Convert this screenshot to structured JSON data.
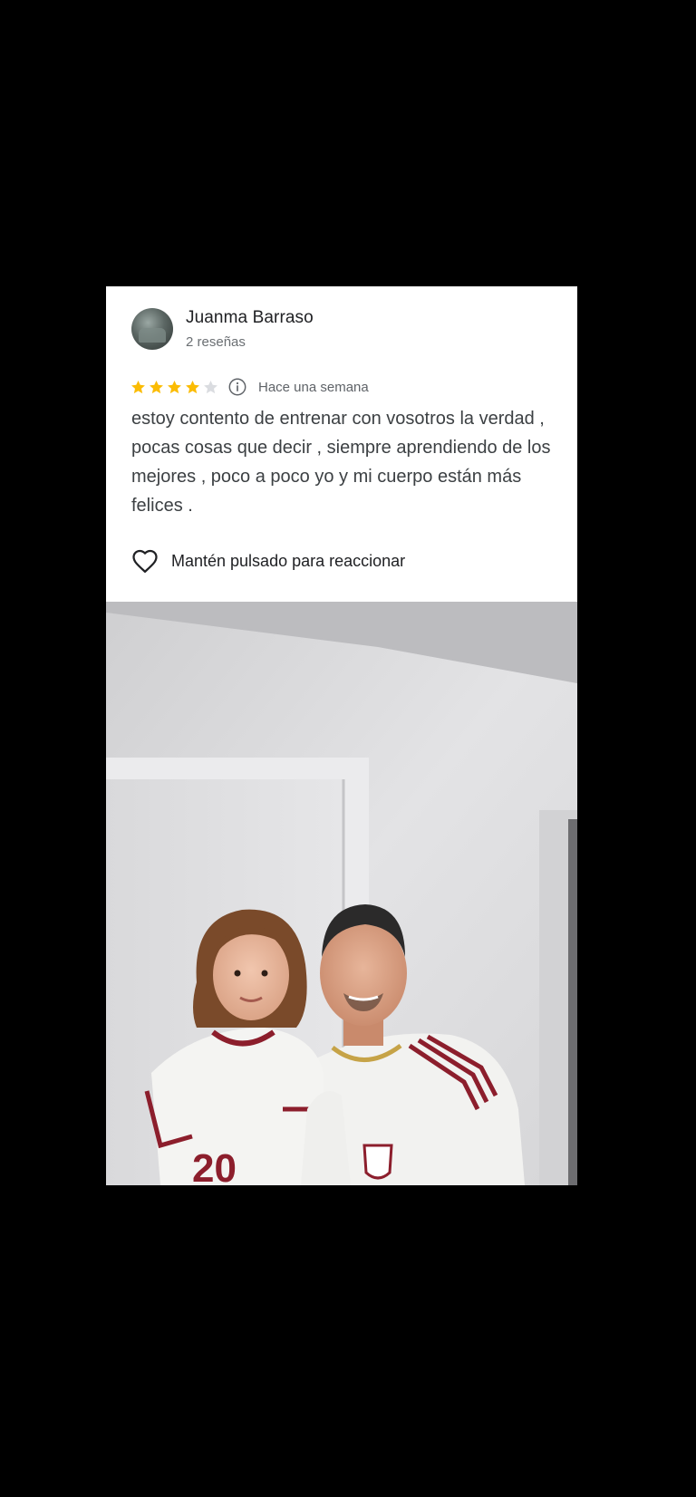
{
  "review": {
    "author_name": "Juanma Barraso",
    "author_meta": "2 reseñas",
    "rating": 4,
    "rating_max": 5,
    "date": "Hace una semana",
    "text": "estoy contento de entrenar con vosotros la verdad , pocas cosas que decir , siempre aprendiendo de los mejores , poco a poco yo y mi cuerpo están más felices .",
    "react_label": "Mantén pulsado para reaccionar"
  },
  "icons": {
    "avatar": "user-avatar",
    "info": "info-icon",
    "heart": "heart-icon",
    "star": "star-icon"
  },
  "colors": {
    "star_filled": "#fbbc04",
    "star_empty": "#dadce0",
    "background": "#000000",
    "card": "#ffffff"
  }
}
